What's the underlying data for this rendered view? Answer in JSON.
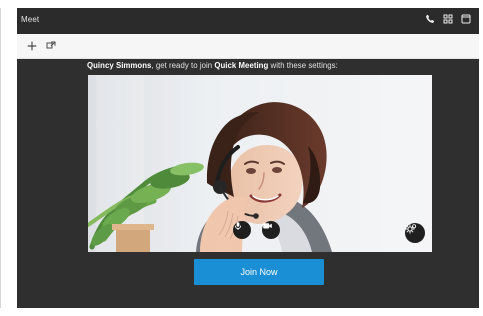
{
  "window": {
    "title": "Meet"
  },
  "toolbar": {
    "add_icon": "plus-icon",
    "share_icon": "share-icon"
  },
  "meeting": {
    "participant_name": "Quincy Simmons",
    "middle_text": ", get ready to join ",
    "meeting_name": "Quick Meeting",
    "end_text": " with these settings:"
  },
  "controls": {
    "mic_icon": "microphone-icon",
    "video_icon": "video-camera-icon",
    "settings_icon": "settings-icon"
  },
  "actions": {
    "join_label": "Join Now"
  },
  "title_actions": {
    "phone_icon": "phone-icon",
    "grid_icon": "grid-icon",
    "window_icon": "window-icon"
  },
  "colors": {
    "window_bg": "#2f2f2f",
    "titlebar_bg": "#2b2b2b",
    "toolbar_bg": "#f6f6f6",
    "join_button": "#1b8fd5"
  }
}
